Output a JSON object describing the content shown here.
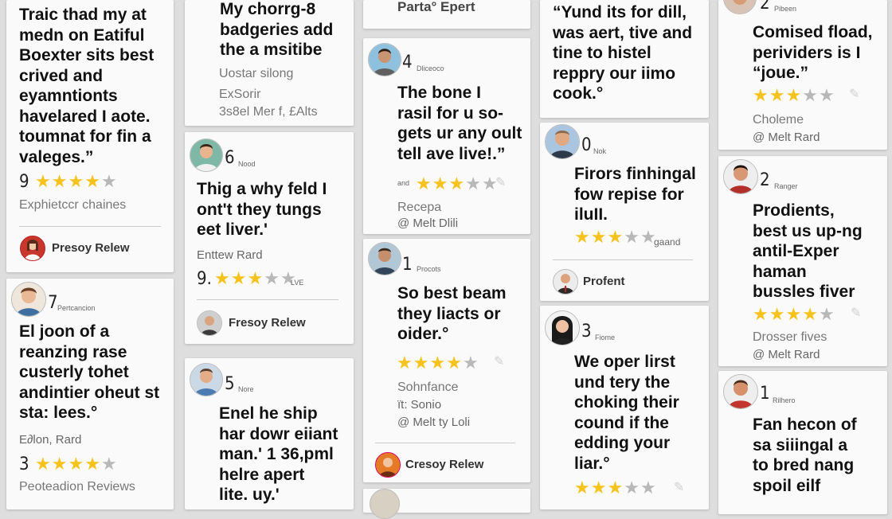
{
  "colors": {
    "star_on": "#f6c21c",
    "star_off": "#b8b8b8",
    "accent": "#d9382c"
  },
  "col1": {
    "card1": {
      "quote": "Traic thad my at\nmedn on Eatiful\nBoexter sits best\ncrived and\neyamntionts\nhavelared I aote.\ntoumnat for fin a\nvaleges.”",
      "number": "9",
      "rating": 4,
      "source": "Exphietccr chaines",
      "user": "Presoy Relew"
    },
    "card2": {
      "number": "7",
      "tag": "Pertcancion",
      "quote": "El joon of a\nreanzing rase\ncusterly tohet\nandintier oheut st\nsta: lees.°",
      "author": "E∂lon, Rard",
      "number2": "3",
      "rating": 4,
      "source": "Peoteadion Reviews"
    }
  },
  "col2": {
    "card1": {
      "quote": "My chorrg-8\nbadgeries add\nthe a msitibe",
      "muted1": "Uostar silong",
      "muted2": "ExSorir",
      "muted3": "3s8el Mer f, £Alts"
    },
    "card2": {
      "number": "6",
      "tag": "Nood",
      "quote": "Thig a why feld I\nont't they tungs\neet liver.'",
      "author": "Enttew Rard",
      "number2": "9.",
      "rating": 3,
      "small": "LVE",
      "user": "Fresoy Relew"
    },
    "card3": {
      "number": "5",
      "tag": "Nore",
      "quote": "Enel he ship\nhar dowr eiiant\nman.' 1 36,pml\nhelre apert\nlite. uy.'"
    }
  },
  "col3": {
    "card1": {
      "title": "Parta° Epert"
    },
    "card2": {
      "number": "4",
      "tag": "Dliceoco",
      "quote": "The bone I\nrasil for u so-\ngets ur any oult\ntell ave live!.”",
      "small": "and",
      "rating": 3,
      "source": "Recepa",
      "handle": "@ Melt Dlili"
    },
    "card3": {
      "number": "1",
      "tag": "Procots",
      "quote": "So best beam\nthey liacts or\noider.°",
      "rating": 4,
      "source": "Sohnfance",
      "source2": "ït: Sonio",
      "handle": "@ Melt ty Loli",
      "user": "Cresoy Relew"
    }
  },
  "col4": {
    "card1": {
      "quote": "“Yund its for dill,\nwas aert, tive and\ntine to histel\nreppry our iimo\ncook.°"
    },
    "card2": {
      "number": "0",
      "tag": "Nok",
      "quote": "Firors finhingal\nfow repise for\niluII.",
      "rating": 3,
      "small": "gaand",
      "user": "Profent"
    },
    "card3": {
      "number": "3",
      "tag": "Fiome",
      "quote": "We oper lirst\nund tery the\nchoking their\ncound if the\nedding your\nliar.°",
      "rating": 3
    }
  },
  "col5": {
    "card1": {
      "number": "2",
      "tag": "Pibeen",
      "quote": "Comised fload,\nperividers is I\n“joue.”",
      "rating": 3,
      "source": "Choleme",
      "handle": "@ Melt Rard"
    },
    "card2": {
      "number": "2",
      "tag": "Ranger",
      "quote": "Prodients,\nbest us up-ng\nantil-Exper\nhaman\nbussles fiver",
      "rating": 4,
      "source": "Drosser fives",
      "handle": "@ Melt Rard"
    },
    "card3": {
      "number": "1",
      "tag": "Rilhero",
      "quote": "Fan hecon of\nsa siiingal a\nto bred nang\nspoil eilf"
    }
  }
}
